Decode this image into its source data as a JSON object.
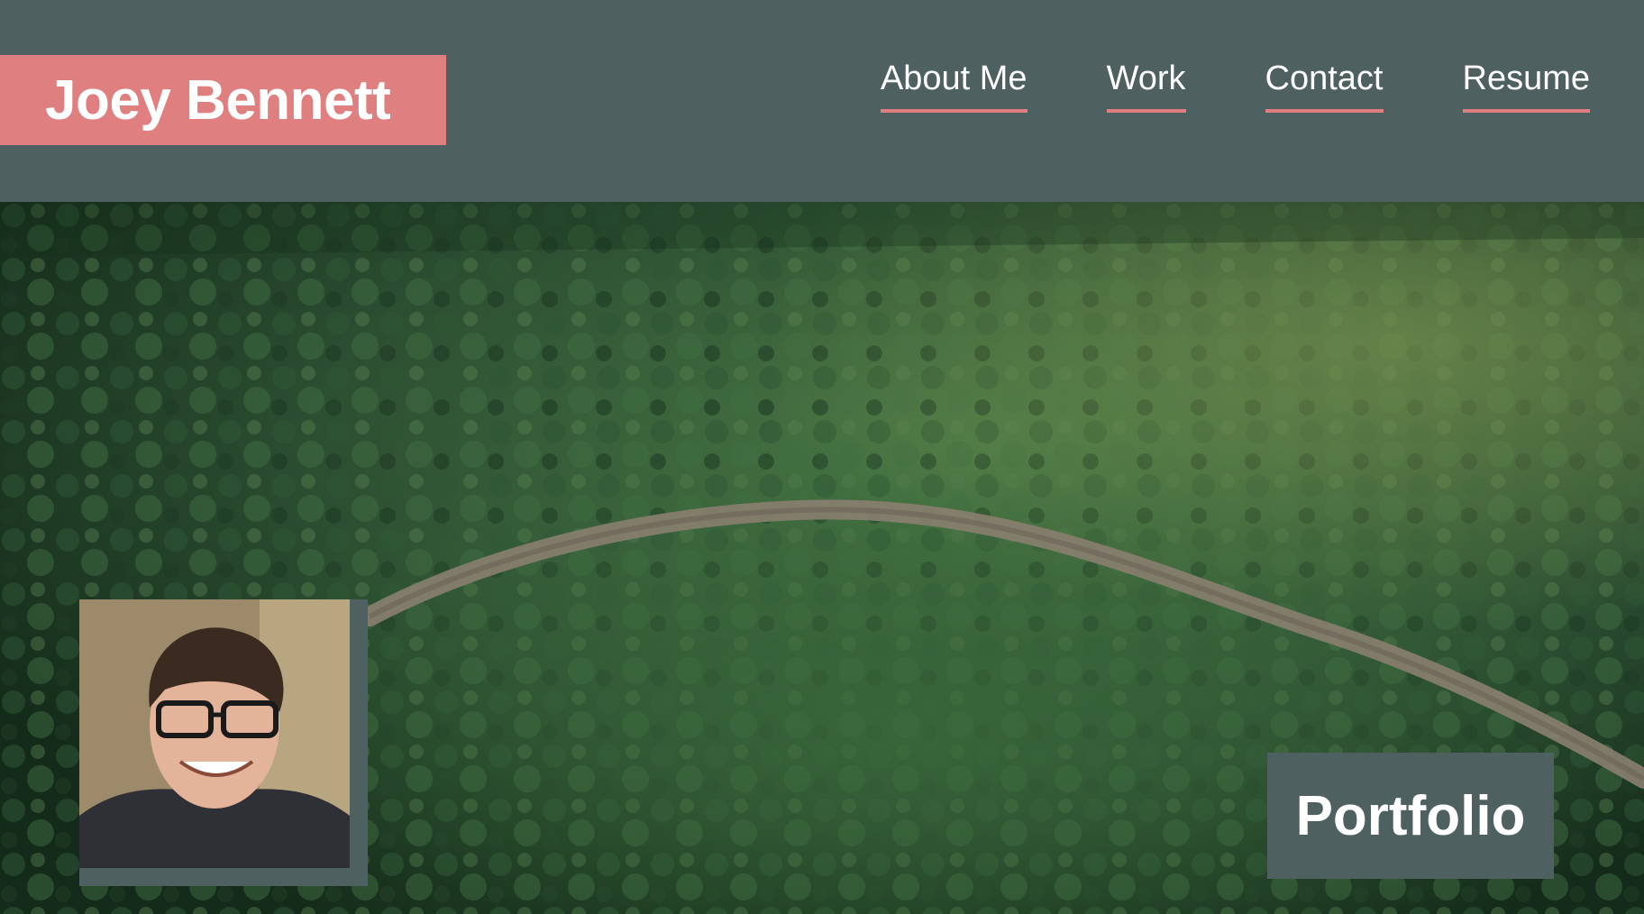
{
  "header": {
    "brand_name": "Joey Bennett",
    "nav": [
      {
        "label": "About Me"
      },
      {
        "label": "Work"
      },
      {
        "label": "Contact"
      },
      {
        "label": "Resume"
      }
    ]
  },
  "hero": {
    "badge_label": "Portfolio",
    "image_subject": "aerial forest with winding dirt road",
    "avatar_subject": "portrait of smiling man with glasses"
  },
  "colors": {
    "header_bg": "#4f6060",
    "accent": "#e07f7f",
    "text": "#ffffff",
    "forest_dark": "#1f3a25",
    "forest_mid": "#3e6a3f",
    "road": "#8a7f70"
  }
}
